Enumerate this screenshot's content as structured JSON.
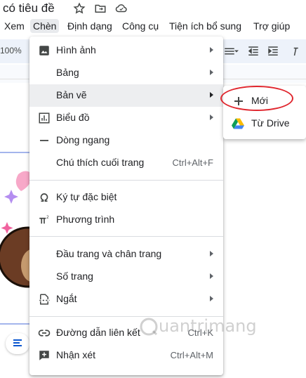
{
  "doc": {
    "title": "có tiêu đề"
  },
  "menubar": {
    "items": [
      "Xem",
      "Chèn",
      "Định dạng",
      "Công cụ",
      "Tiện ích bổ sung",
      "Trợ giúp"
    ],
    "active": "Chèn"
  },
  "toolbar": {
    "zoom": "100%"
  },
  "insert_menu": {
    "items": [
      {
        "label": "Hình ảnh",
        "icon": "image-icon",
        "submenu": true
      },
      {
        "label": "Bảng",
        "submenu": true
      },
      {
        "label": "Bản vẽ",
        "submenu": true
      },
      {
        "label": "Biểu đồ",
        "icon": "chart-icon",
        "submenu": true
      },
      {
        "label": "Dòng ngang",
        "icon": "horizontal-line-icon"
      },
      {
        "label": "Chú thích cuối trang",
        "shortcut": "Ctrl+Alt+F"
      },
      {
        "label": "Ký tự đặc biệt",
        "icon": "omega-icon"
      },
      {
        "label": "Phương trình",
        "icon": "pi-icon"
      },
      {
        "label": "Đầu trang và chân trang",
        "submenu": true
      },
      {
        "label": "Số trang",
        "submenu": true
      },
      {
        "label": "Ngắt",
        "icon": "page-break-icon",
        "submenu": true
      },
      {
        "label": "Đường dẫn liên kết",
        "icon": "link-icon",
        "shortcut": "Ctrl+K"
      },
      {
        "label": "Nhận xét",
        "icon": "comment-add-icon",
        "shortcut": "Ctrl+Alt+M"
      }
    ]
  },
  "drawing_submenu": {
    "items": [
      {
        "label": "Mới",
        "icon": "plus-icon"
      },
      {
        "label": "Từ Drive",
        "icon": "google-drive-icon"
      }
    ]
  },
  "watermark": {
    "text": "uantrimang"
  },
  "colors": {
    "highlight": "#edeef0",
    "annotation": "#e0262e",
    "toolbar_bg": "#edf2fa"
  }
}
